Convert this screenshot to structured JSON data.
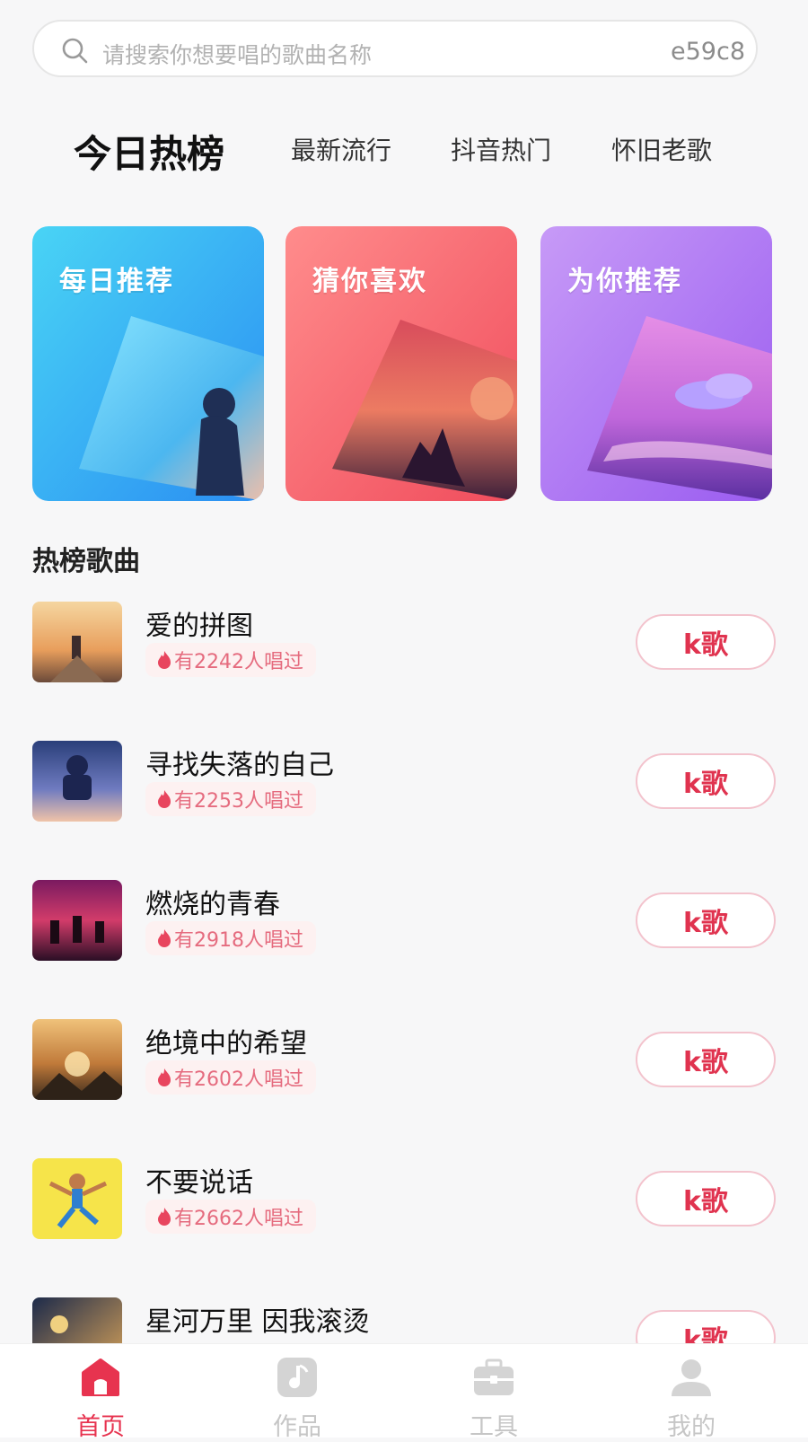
{
  "search": {
    "placeholder": "请搜索你想要唱的歌曲名称",
    "code": "e59c8"
  },
  "tabs": [
    {
      "label": "今日热榜",
      "active": true
    },
    {
      "label": "最新流行"
    },
    {
      "label": "抖音热门"
    },
    {
      "label": "怀旧老歌"
    }
  ],
  "cards": [
    {
      "title": "每日推荐"
    },
    {
      "title": "猜你喜欢"
    },
    {
      "title": "为你推荐"
    }
  ],
  "section_title": "热榜歌曲",
  "songs": [
    {
      "name": "爱的拼图",
      "sung": "有2242人唱过",
      "button": "k歌"
    },
    {
      "name": "寻找失落的自己",
      "sung": "有2253人唱过",
      "button": "k歌"
    },
    {
      "name": "燃烧的青春",
      "sung": "有2918人唱过",
      "button": "k歌"
    },
    {
      "name": "绝境中的希望",
      "sung": "有2602人唱过",
      "button": "k歌"
    },
    {
      "name": "不要说话",
      "sung": "有2662人唱过",
      "button": "k歌"
    },
    {
      "name": "星河万里 因我滚烫",
      "sung": "",
      "button": "k歌"
    }
  ],
  "nav": [
    {
      "label": "首页",
      "icon": "home-icon",
      "active": true
    },
    {
      "label": "作品",
      "icon": "music-note-icon"
    },
    {
      "label": "工具",
      "icon": "toolbox-icon"
    },
    {
      "label": "我的",
      "icon": "user-icon"
    }
  ],
  "colors": {
    "accent": "#e7334f",
    "tag_text": "#e56b7e",
    "tag_bg": "#fdf1f1"
  }
}
